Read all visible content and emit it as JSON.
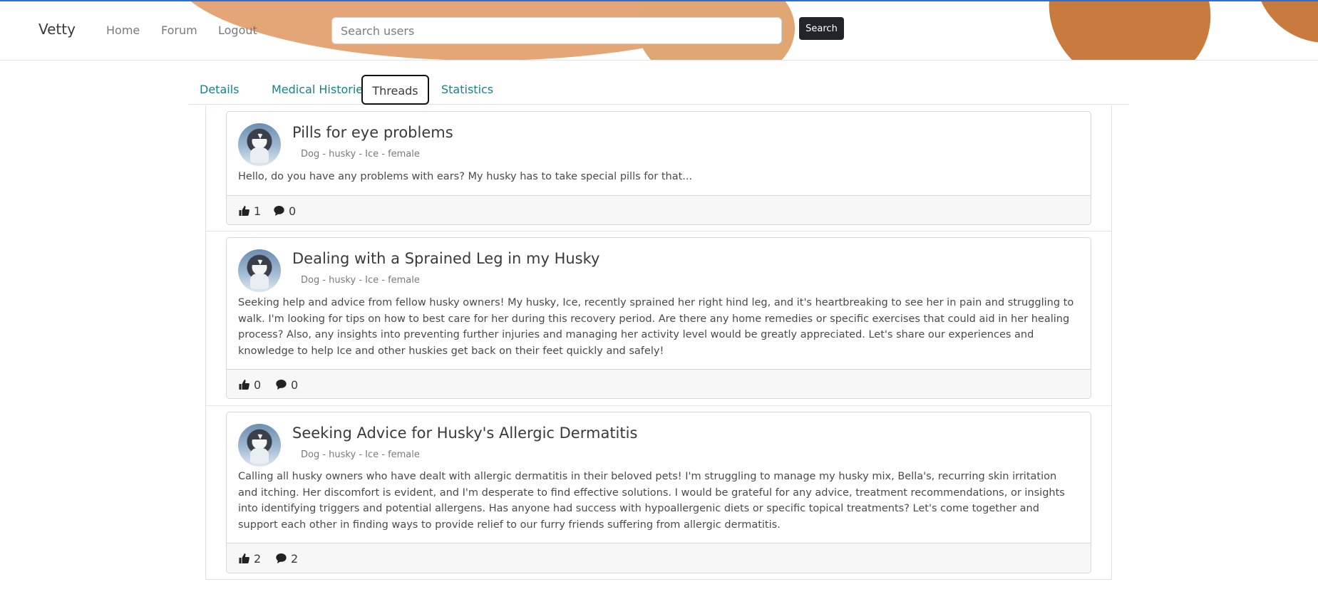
{
  "navbar": {
    "brand": "Vetty",
    "links": [
      "Home",
      "Forum",
      "Logout"
    ],
    "search": {
      "placeholder": "Search users",
      "value": "",
      "button_label": "Search"
    },
    "accent_color": "#e4a676"
  },
  "tabs": {
    "items": [
      "Details",
      "Medical Histories",
      "Threads",
      "Statistics"
    ],
    "active": "Threads",
    "color": "#1b7f86"
  },
  "threads": [
    {
      "title": "Pills for eye problems",
      "meta": "Dog - husky - Ice - female",
      "content": "Hello, do you have any problems with ears? My husky has to take special pills for that...",
      "likes": "1",
      "comments": "0"
    },
    {
      "title": "Dealing with a Sprained Leg in my Husky",
      "meta": "Dog - husky - Ice - female",
      "content": "Seeking help and advice from fellow husky owners! My husky, Ice, recently sprained her right hind leg, and it's heartbreaking to see her in pain and struggling to walk. I'm looking for tips on how to best care for her during this recovery period. Are there any home remedies or specific exercises that could aid in her healing process? Also, any insights into preventing further injuries and managing her activity level would be greatly appreciated. Let's share our experiences and knowledge to help Ice and other huskies get back on their feet quickly and safely!",
      "likes": "0",
      "comments": "0"
    },
    {
      "title": "Seeking Advice for Husky's Allergic Dermatitis",
      "meta": "Dog - husky - Ice - female",
      "content": "Calling all husky owners who have dealt with allergic dermatitis in their beloved pets! I'm struggling to manage my husky mix, Bella's, recurring skin irritation and itching. Her discomfort is evident, and I'm desperate to find effective solutions. I would be grateful for any advice, treatment recommendations, or insights into identifying triggers and potential allergens. Has anyone had success with hypoallergenic diets or specific topical treatments? Let's come together and support each other in finding ways to provide relief to our furry friends suffering from allergic dermatitis.",
      "likes": "2",
      "comments": "2"
    }
  ]
}
